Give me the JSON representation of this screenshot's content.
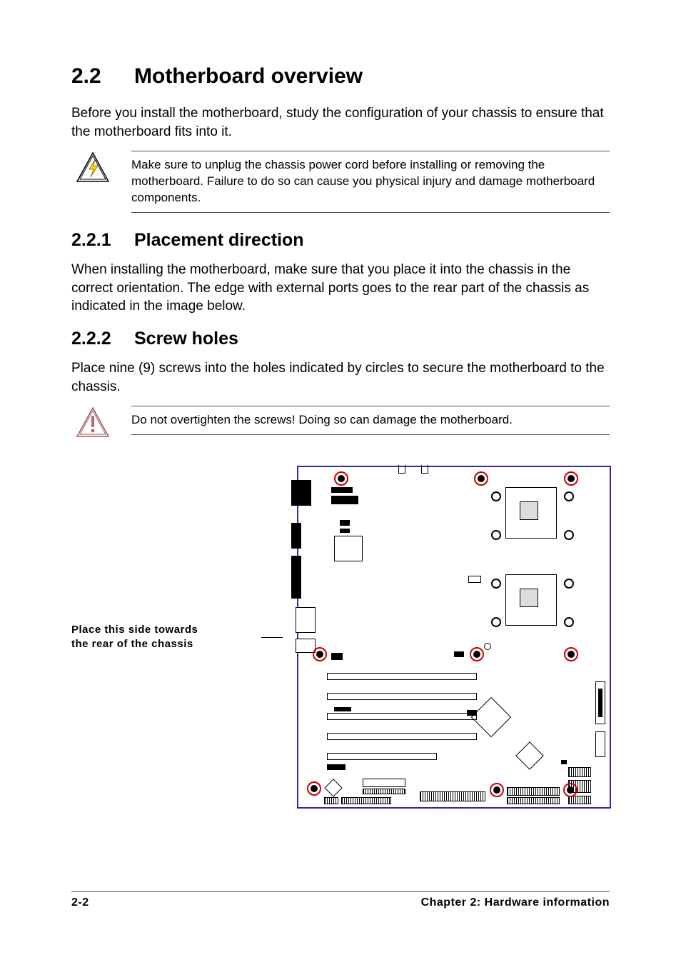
{
  "heading": {
    "number": "2.2",
    "title": "Motherboard overview"
  },
  "intro": "Before you install the motherboard, study the configuration of your chassis to ensure that the motherboard fits into it.",
  "warning1": "Make sure to unplug the chassis power cord before installing or removing the motherboard. Failure to do so can cause you physical injury and damage motherboard components.",
  "section1": {
    "number": "2.2.1",
    "title": "Placement direction"
  },
  "para1": "When installing the motherboard, make sure that you place it into the chassis in the correct orientation. The edge with external ports goes to the rear part of the chassis as indicated in the image below.",
  "section2": {
    "number": "2.2.2",
    "title": "Screw holes"
  },
  "para2": "Place nine (9) screws into the holes indicated by circles to secure the motherboard to the chassis.",
  "warning2": "Do not overtighten the screws! Doing so can damage the motherboard.",
  "diagram_label_line1": "Place this side towards",
  "diagram_label_line2": "the rear of the chassis",
  "footer": {
    "page": "2-2",
    "chapter": "Chapter 2: Hardware information"
  }
}
